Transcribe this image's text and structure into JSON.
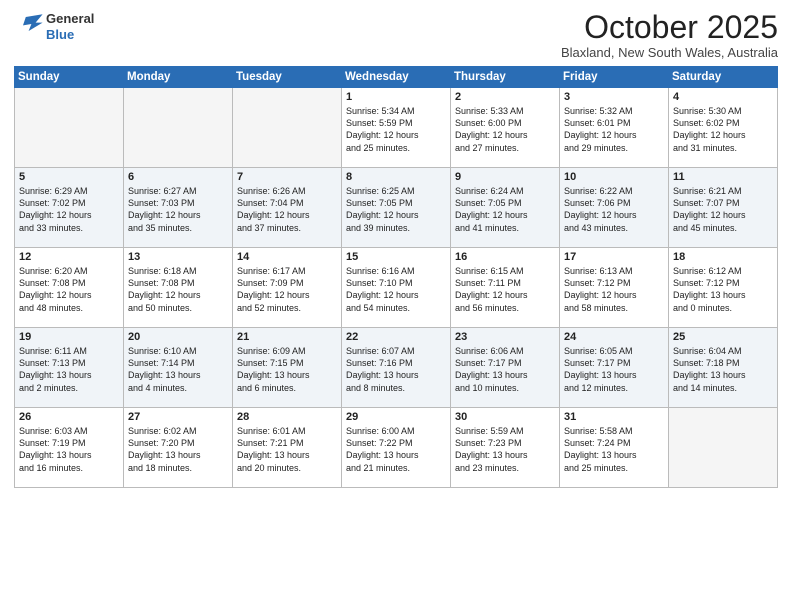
{
  "logo": {
    "line1": "General",
    "line2": "Blue"
  },
  "title": "October 2025",
  "location": "Blaxland, New South Wales, Australia",
  "days_of_week": [
    "Sunday",
    "Monday",
    "Tuesday",
    "Wednesday",
    "Thursday",
    "Friday",
    "Saturday"
  ],
  "weeks": [
    [
      {
        "day": "",
        "text": ""
      },
      {
        "day": "",
        "text": ""
      },
      {
        "day": "",
        "text": ""
      },
      {
        "day": "1",
        "text": "Sunrise: 5:34 AM\nSunset: 5:59 PM\nDaylight: 12 hours\nand 25 minutes."
      },
      {
        "day": "2",
        "text": "Sunrise: 5:33 AM\nSunset: 6:00 PM\nDaylight: 12 hours\nand 27 minutes."
      },
      {
        "day": "3",
        "text": "Sunrise: 5:32 AM\nSunset: 6:01 PM\nDaylight: 12 hours\nand 29 minutes."
      },
      {
        "day": "4",
        "text": "Sunrise: 5:30 AM\nSunset: 6:02 PM\nDaylight: 12 hours\nand 31 minutes."
      }
    ],
    [
      {
        "day": "5",
        "text": "Sunrise: 6:29 AM\nSunset: 7:02 PM\nDaylight: 12 hours\nand 33 minutes."
      },
      {
        "day": "6",
        "text": "Sunrise: 6:27 AM\nSunset: 7:03 PM\nDaylight: 12 hours\nand 35 minutes."
      },
      {
        "day": "7",
        "text": "Sunrise: 6:26 AM\nSunset: 7:04 PM\nDaylight: 12 hours\nand 37 minutes."
      },
      {
        "day": "8",
        "text": "Sunrise: 6:25 AM\nSunset: 7:05 PM\nDaylight: 12 hours\nand 39 minutes."
      },
      {
        "day": "9",
        "text": "Sunrise: 6:24 AM\nSunset: 7:05 PM\nDaylight: 12 hours\nand 41 minutes."
      },
      {
        "day": "10",
        "text": "Sunrise: 6:22 AM\nSunset: 7:06 PM\nDaylight: 12 hours\nand 43 minutes."
      },
      {
        "day": "11",
        "text": "Sunrise: 6:21 AM\nSunset: 7:07 PM\nDaylight: 12 hours\nand 45 minutes."
      }
    ],
    [
      {
        "day": "12",
        "text": "Sunrise: 6:20 AM\nSunset: 7:08 PM\nDaylight: 12 hours\nand 48 minutes."
      },
      {
        "day": "13",
        "text": "Sunrise: 6:18 AM\nSunset: 7:08 PM\nDaylight: 12 hours\nand 50 minutes."
      },
      {
        "day": "14",
        "text": "Sunrise: 6:17 AM\nSunset: 7:09 PM\nDaylight: 12 hours\nand 52 minutes."
      },
      {
        "day": "15",
        "text": "Sunrise: 6:16 AM\nSunset: 7:10 PM\nDaylight: 12 hours\nand 54 minutes."
      },
      {
        "day": "16",
        "text": "Sunrise: 6:15 AM\nSunset: 7:11 PM\nDaylight: 12 hours\nand 56 minutes."
      },
      {
        "day": "17",
        "text": "Sunrise: 6:13 AM\nSunset: 7:12 PM\nDaylight: 12 hours\nand 58 minutes."
      },
      {
        "day": "18",
        "text": "Sunrise: 6:12 AM\nSunset: 7:12 PM\nDaylight: 13 hours\nand 0 minutes."
      }
    ],
    [
      {
        "day": "19",
        "text": "Sunrise: 6:11 AM\nSunset: 7:13 PM\nDaylight: 13 hours\nand 2 minutes."
      },
      {
        "day": "20",
        "text": "Sunrise: 6:10 AM\nSunset: 7:14 PM\nDaylight: 13 hours\nand 4 minutes."
      },
      {
        "day": "21",
        "text": "Sunrise: 6:09 AM\nSunset: 7:15 PM\nDaylight: 13 hours\nand 6 minutes."
      },
      {
        "day": "22",
        "text": "Sunrise: 6:07 AM\nSunset: 7:16 PM\nDaylight: 13 hours\nand 8 minutes."
      },
      {
        "day": "23",
        "text": "Sunrise: 6:06 AM\nSunset: 7:17 PM\nDaylight: 13 hours\nand 10 minutes."
      },
      {
        "day": "24",
        "text": "Sunrise: 6:05 AM\nSunset: 7:17 PM\nDaylight: 13 hours\nand 12 minutes."
      },
      {
        "day": "25",
        "text": "Sunrise: 6:04 AM\nSunset: 7:18 PM\nDaylight: 13 hours\nand 14 minutes."
      }
    ],
    [
      {
        "day": "26",
        "text": "Sunrise: 6:03 AM\nSunset: 7:19 PM\nDaylight: 13 hours\nand 16 minutes."
      },
      {
        "day": "27",
        "text": "Sunrise: 6:02 AM\nSunset: 7:20 PM\nDaylight: 13 hours\nand 18 minutes."
      },
      {
        "day": "28",
        "text": "Sunrise: 6:01 AM\nSunset: 7:21 PM\nDaylight: 13 hours\nand 20 minutes."
      },
      {
        "day": "29",
        "text": "Sunrise: 6:00 AM\nSunset: 7:22 PM\nDaylight: 13 hours\nand 21 minutes."
      },
      {
        "day": "30",
        "text": "Sunrise: 5:59 AM\nSunset: 7:23 PM\nDaylight: 13 hours\nand 23 minutes."
      },
      {
        "day": "31",
        "text": "Sunrise: 5:58 AM\nSunset: 7:24 PM\nDaylight: 13 hours\nand 25 minutes."
      },
      {
        "day": "",
        "text": ""
      }
    ]
  ]
}
